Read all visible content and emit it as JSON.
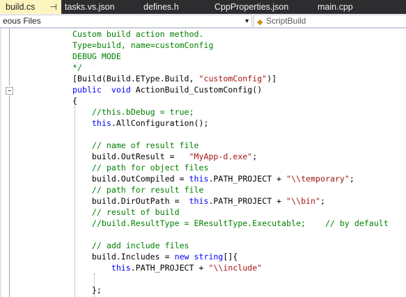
{
  "tabs": [
    {
      "label": "build.cs",
      "active": true,
      "pin": "⊣"
    },
    {
      "label": "tasks.vs.json",
      "active": false
    },
    {
      "label": "defines.h",
      "active": false
    },
    {
      "label": "CppProperties.json",
      "active": false
    },
    {
      "label": "main.cpp",
      "active": false
    }
  ],
  "navbar": {
    "scope_value": "eous Files",
    "member_value": "ScriptBuild"
  },
  "colors": {
    "comment": "#008000",
    "keyword": "#0000ff",
    "string": "#a31515",
    "tab_active_bg": "#fdf4bf",
    "tabbar_bg": "#2d2d30"
  },
  "code": {
    "lines": [
      [
        {
          "t": "Custom build action method.",
          "c": "cm"
        }
      ],
      [
        {
          "t": "Type=build, name=customConfig",
          "c": "cm"
        }
      ],
      [
        {
          "t": "DEBUG MODE",
          "c": "cm"
        }
      ],
      [
        {
          "t": "*/",
          "c": "cm"
        }
      ],
      [
        {
          "t": "[Build(Build.EType.Build, ",
          "c": "pl"
        },
        {
          "t": "\"customConfig\"",
          "c": "st"
        },
        {
          "t": ")]",
          "c": "pl"
        }
      ],
      [
        {
          "t": "public",
          "c": "kw"
        },
        {
          "t": "  ",
          "c": "pl"
        },
        {
          "t": "void",
          "c": "kw"
        },
        {
          "t": " ActionBuild_CustomConfig()",
          "c": "pl"
        }
      ],
      [
        {
          "t": "{",
          "c": "pl"
        }
      ],
      [
        {
          "t": "    //this.bDebug = true;",
          "c": "cm"
        }
      ],
      [
        {
          "t": "    ",
          "c": "pl"
        },
        {
          "t": "this",
          "c": "kw"
        },
        {
          "t": ".AllConfiguration();",
          "c": "pl"
        }
      ],
      [
        {
          "t": "",
          "c": "pl"
        }
      ],
      [
        {
          "t": "    // name of result file",
          "c": "cm"
        }
      ],
      [
        {
          "t": "    build.OutResult =   ",
          "c": "pl"
        },
        {
          "t": "\"MyApp-d.exe\"",
          "c": "st"
        },
        {
          "t": ";",
          "c": "pl"
        }
      ],
      [
        {
          "t": "    // path for object files",
          "c": "cm"
        }
      ],
      [
        {
          "t": "    build.OutCompiled = ",
          "c": "pl"
        },
        {
          "t": "this",
          "c": "kw"
        },
        {
          "t": ".PATH_PROJECT + ",
          "c": "pl"
        },
        {
          "t": "\"\\\\temporary\"",
          "c": "st"
        },
        {
          "t": ";",
          "c": "pl"
        }
      ],
      [
        {
          "t": "    // path for result file",
          "c": "cm"
        }
      ],
      [
        {
          "t": "    build.DirOutPath =  ",
          "c": "pl"
        },
        {
          "t": "this",
          "c": "kw"
        },
        {
          "t": ".PATH_PROJECT + ",
          "c": "pl"
        },
        {
          "t": "\"\\\\bin\"",
          "c": "st"
        },
        {
          "t": ";",
          "c": "pl"
        }
      ],
      [
        {
          "t": "    // result of build",
          "c": "cm"
        }
      ],
      [
        {
          "t": "    //build.ResultType = EResultType.Executable;    // by default",
          "c": "cm"
        }
      ],
      [
        {
          "t": "",
          "c": "pl"
        }
      ],
      [
        {
          "t": "    // add include files",
          "c": "cm"
        }
      ],
      [
        {
          "t": "    build.Includes = ",
          "c": "pl"
        },
        {
          "t": "new",
          "c": "kw"
        },
        {
          "t": " ",
          "c": "pl"
        },
        {
          "t": "string",
          "c": "kw"
        },
        {
          "t": "[]{",
          "c": "pl"
        }
      ],
      [
        {
          "t": "        ",
          "c": "pl"
        },
        {
          "t": "this",
          "c": "kw"
        },
        {
          "t": ".PATH_PROJECT + ",
          "c": "pl"
        },
        {
          "t": "\"\\\\include\"",
          "c": "st"
        }
      ],
      [
        {
          "t": "",
          "c": "pl"
        }
      ],
      [
        {
          "t": "    };",
          "c": "pl"
        }
      ]
    ]
  }
}
